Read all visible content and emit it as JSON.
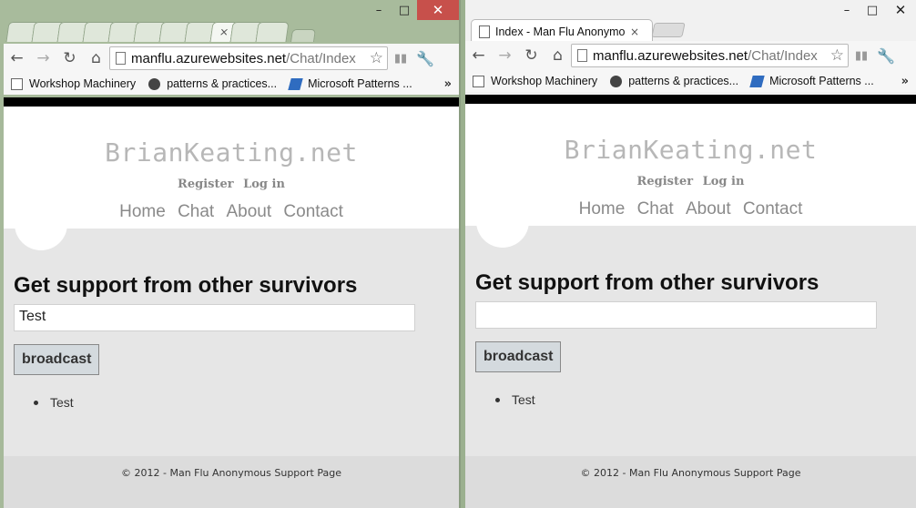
{
  "browser": {
    "left": {
      "tab_close": "×",
      "url_host": "manflu.azurewebsites.net",
      "url_path": "/Chat/Index"
    },
    "right": {
      "tab_title": "Index - Man Flu Anonymous Support Page",
      "tab_close": "×",
      "url_host": "manflu.azurewebsites.net",
      "url_path": "/Chat/Index"
    },
    "caption": {
      "minimize": "–",
      "maximize": "□",
      "close": "✕"
    },
    "icons": {
      "back": "←",
      "forward": "→",
      "reload": "↻",
      "home": "⌂",
      "star": "☆",
      "wrench": "🔧",
      "extension": "▮▮",
      "overflow": "»"
    },
    "bookmarks": [
      "Workshop Machinery",
      "patterns & practices...",
      "Microsoft Patterns ..."
    ]
  },
  "site": {
    "title": "BrianKeating.net",
    "register": "Register",
    "login": "Log in",
    "menu": [
      "Home",
      "Chat",
      "About",
      "Contact"
    ],
    "heading": "Get support from other survivors",
    "broadcast_label": "broadcast",
    "footer": "© 2012 - Man Flu Anonymous Support Page"
  },
  "left_page": {
    "input_value": "Test",
    "messages": [
      "Test"
    ]
  },
  "right_page": {
    "input_value": "",
    "messages": [
      "Test"
    ]
  }
}
